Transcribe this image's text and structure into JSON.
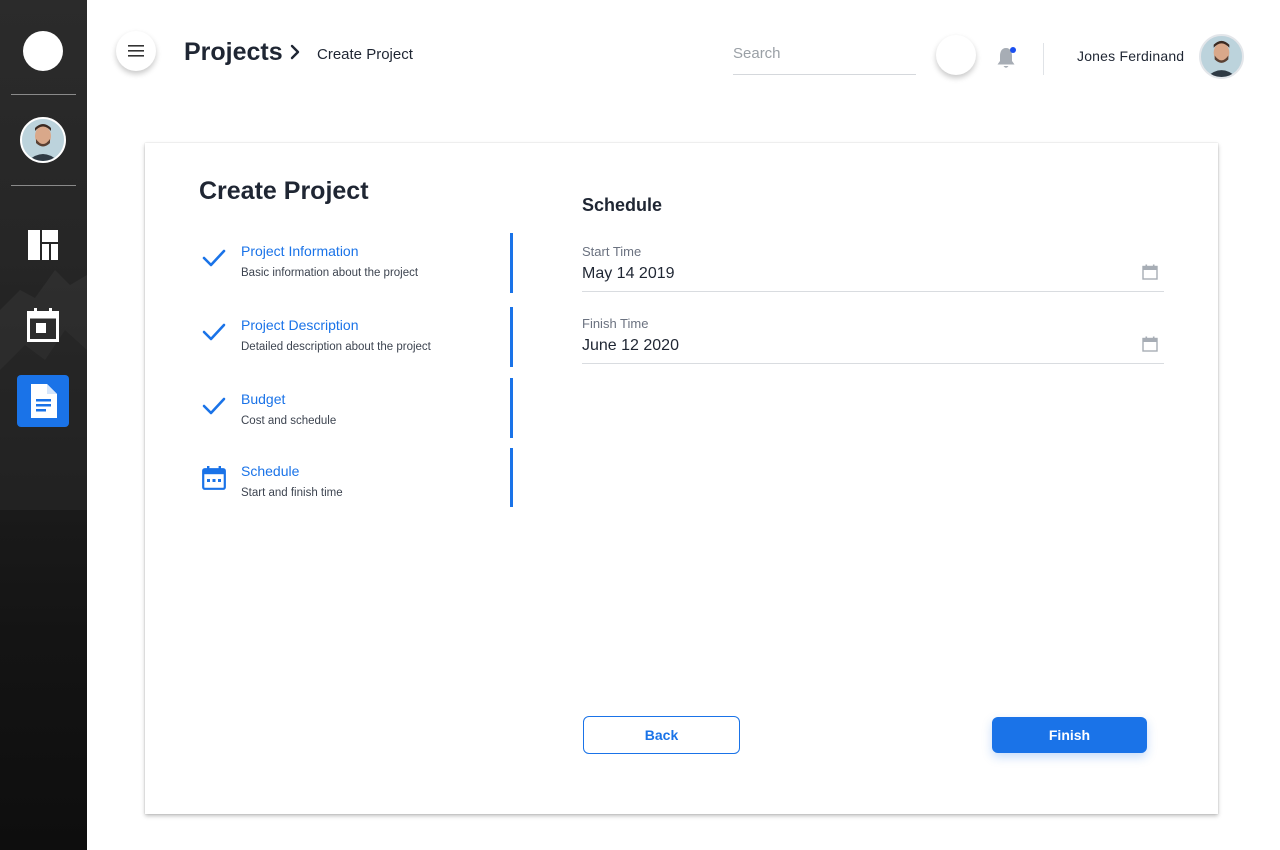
{
  "sidebar": {
    "items": [
      {
        "icon": "dashboard-icon"
      },
      {
        "icon": "calendar-icon"
      },
      {
        "icon": "document-icon",
        "active": true
      }
    ]
  },
  "header": {
    "breadcrumb_main": "Projects",
    "breadcrumb_sub": "Create Project",
    "search_placeholder": "Search",
    "user_name": "Jones Ferdinand"
  },
  "card": {
    "title": "Create Project",
    "steps": [
      {
        "label": "Project Information",
        "desc": "Basic information about the project",
        "status": "done"
      },
      {
        "label": "Project Description",
        "desc": "Detailed description about the project",
        "status": "done"
      },
      {
        "label": "Budget",
        "desc": "Cost and schedule",
        "status": "done"
      },
      {
        "label": "Schedule",
        "desc": "Start and finish time",
        "status": "current"
      }
    ],
    "section_title": "Schedule",
    "fields": [
      {
        "label": "Start Time",
        "value": "May 14 2019"
      },
      {
        "label": "Finish Time",
        "value": "June 12 2020"
      }
    ],
    "back_label": "Back",
    "finish_label": "Finish"
  },
  "colors": {
    "accent": "#1a73e8",
    "sidebar_bg": "#1c1c1c",
    "notification_dot": "#1a4ff0"
  }
}
